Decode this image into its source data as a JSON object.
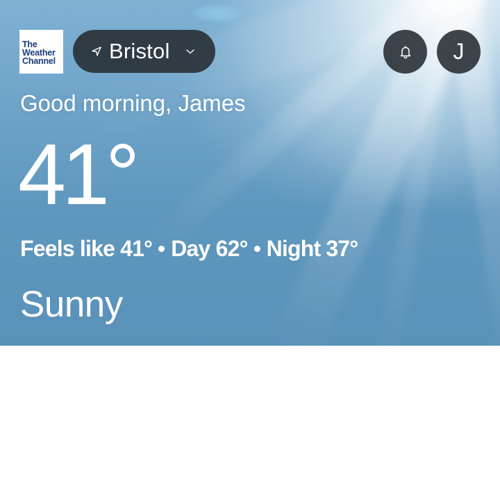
{
  "brand": {
    "logo_lines": [
      "The",
      "Weather",
      "Channel"
    ],
    "logo_color": "#1a3a78"
  },
  "location": {
    "name": "Bristol",
    "icon": "location-arrow-icon",
    "dropdown_icon": "chevron-down-icon"
  },
  "header": {
    "notifications_icon": "bell-icon",
    "avatar_initial": "J"
  },
  "greeting": "Good morning, James",
  "current": {
    "temperature": "41°",
    "feels_like": "Feels like 41°",
    "day": "Day 62°",
    "night": "Night 37°",
    "condition": "Sunny"
  },
  "colors": {
    "pill_background": "#262b31",
    "sky": "#6fa4c9"
  }
}
